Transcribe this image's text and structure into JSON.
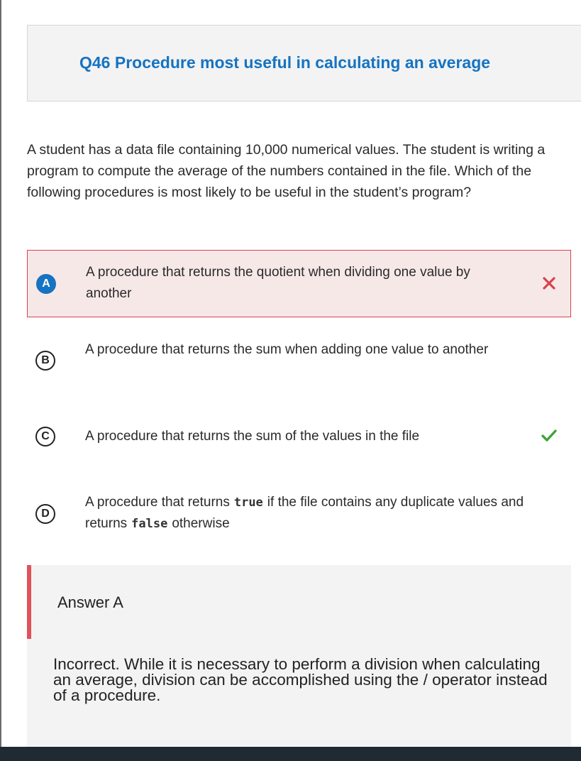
{
  "question": {
    "title": "Q46 Procedure most useful in calculating an average",
    "stem": "A student has a data file containing 10,000 numerical values. The student is writing a program to compute the average of the numbers contained in the file. Which of the following procedures is most likely to be useful in the student’s program?"
  },
  "options": [
    {
      "letter": "A",
      "text": "A procedure that returns the quotient when dividing one value by another",
      "state": "selected-incorrect",
      "mark_icon": "x-icon"
    },
    {
      "letter": "B",
      "text": "A procedure that returns the sum when adding one value to another",
      "state": "unselected"
    },
    {
      "letter": "C",
      "text": "A procedure that returns the sum of the values in the file",
      "state": "correct",
      "mark_icon": "checkmark-icon"
    },
    {
      "letter": "D",
      "text_before": "A procedure that returns",
      "code1": "true",
      "text_middle": "if the file contains any duplicate values and returns",
      "code2": "false",
      "text_after": "otherwise",
      "state": "unselected"
    }
  ],
  "answer": {
    "title": "Answer A",
    "explanation": "Incorrect. While it is necessary to perform a division when calculating an average, division can be accomplished using the / operator instead of a procedure."
  },
  "colors": {
    "accent": "#1573c2",
    "incorrect": "#d9414f",
    "correct": "#3fa535",
    "incorrect_bg": "#f7e8e8",
    "panel_bg": "#f3f3f3"
  }
}
